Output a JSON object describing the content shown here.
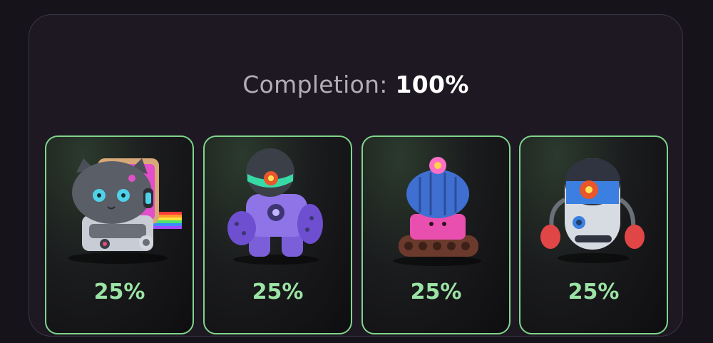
{
  "completion": {
    "label": "Completion:",
    "value": "100%"
  },
  "cards": [
    {
      "name": "cat-robot",
      "value": "25%"
    },
    {
      "name": "astronaut-robot",
      "value": "25%"
    },
    {
      "name": "cactus-tank-robot",
      "value": "25%"
    },
    {
      "name": "boxer-capsule-robot",
      "value": "25%"
    }
  ],
  "colors": {
    "accent_green": "#7fd58a",
    "percent_green": "#9be3a4",
    "background": "#17131b"
  }
}
